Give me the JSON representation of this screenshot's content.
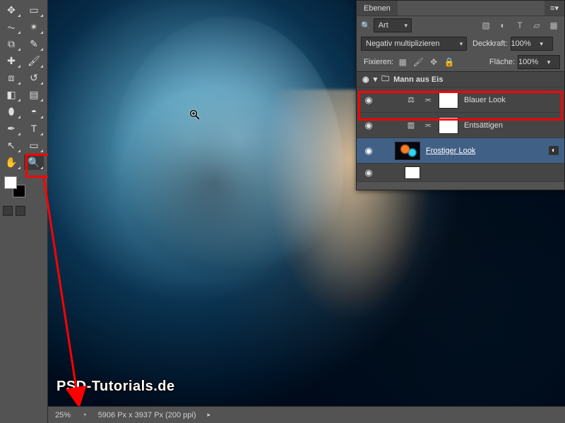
{
  "panel": {
    "title": "Ebenen",
    "filter_label": "Art",
    "blend_mode": "Negativ multiplizieren",
    "opacity_label": "Deckkraft:",
    "opacity_value": "100%",
    "lock_label": "Fixieren:",
    "fill_label": "Fläche:",
    "fill_value": "100%"
  },
  "layers": {
    "group_name": "Mann aus Eis",
    "items": [
      {
        "name": "Blauer Look"
      },
      {
        "name": "Entsättigen"
      },
      {
        "name": "Frostiger Look"
      }
    ]
  },
  "status": {
    "zoom": "25%",
    "doc_info": "5906 Px x 3937 Px (200 ppi)"
  },
  "icons": {
    "eye": "◉",
    "balance": "⚖",
    "link": "⫘",
    "lock": "🔒",
    "folder": "🗀",
    "triangle_down": "▾",
    "triangle_right": "▸",
    "menu": "≡▾",
    "search": "🔍",
    "img": "▧",
    "adj": "◐",
    "type": "T",
    "filter": "▱"
  },
  "watermark": "PSD-Tutorials.de",
  "toolbar": {
    "rows": [
      [
        "move",
        "marquee"
      ],
      [
        "lasso",
        "wand"
      ],
      [
        "crop",
        "eyedrop"
      ],
      [
        "heal",
        "brush"
      ],
      [
        "stamp",
        "history"
      ],
      [
        "eraser",
        "gradient"
      ],
      [
        "blur",
        "dodge"
      ],
      [
        "pen",
        "type"
      ],
      [
        "path",
        "shape"
      ],
      [
        "hand",
        "zoom"
      ]
    ],
    "glyphs": {
      "move": "✥",
      "marquee": "▭",
      "lasso": "⏦",
      "wand": "✴",
      "crop": "⧉",
      "eyedrop": "✎",
      "heal": "✚",
      "brush": "🖌",
      "stamp": "⧈",
      "history": "↺",
      "eraser": "◧",
      "gradient": "▤",
      "blur": "⬮",
      "dodge": "◓",
      "pen": "✒",
      "type": "T",
      "path": "↖",
      "shape": "▭",
      "hand": "✋",
      "zoom": "🔍"
    }
  }
}
